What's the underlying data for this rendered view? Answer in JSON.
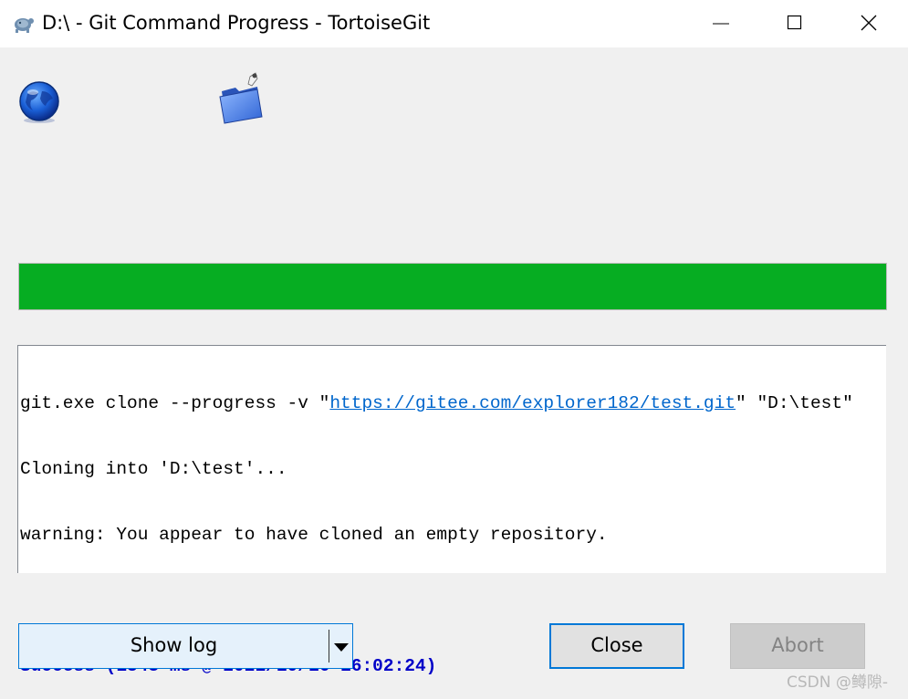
{
  "window": {
    "title": "D:\\ - Git Command Progress - TortoiseGit",
    "app_icon": "tortoisegit-icon",
    "controls": [
      "minimize-icon",
      "maximize-icon",
      "close-icon"
    ]
  },
  "icons": {
    "globe": "globe-icon",
    "folder": "folder-icon"
  },
  "progress": {
    "value": 1.0,
    "color": "#06ad22"
  },
  "log": {
    "command_prefix": "git.exe clone --progress -v \"",
    "url": "https://gitee.com/explorer182/test.git",
    "command_suffix": "\" \"D:\\test\"",
    "lines": [
      "Cloning into 'D:\\test'...",
      "warning: You appear to have cloned an empty repository."
    ],
    "success": "Success (1843 ms @ 2021/10/16 16:02:24)",
    "link_color": "#0066cc",
    "success_color": "#0000c8"
  },
  "buttons": {
    "show_log": "Show log",
    "close": "Close",
    "abort": "Abort"
  },
  "watermark": "CSDN @鳟隙-"
}
